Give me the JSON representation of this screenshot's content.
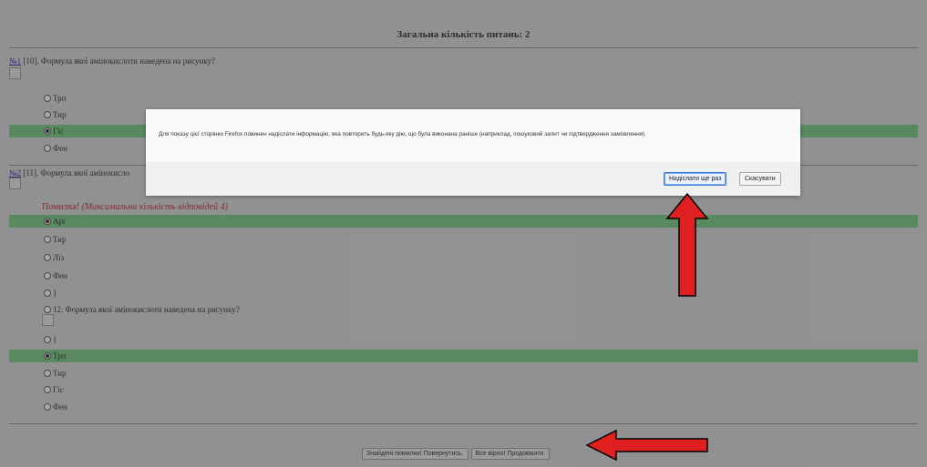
{
  "page": {
    "total_title": "Загальна кількість питань: 2",
    "questions": [
      {
        "number_link": "№1",
        "text": " [10]. Формула якої амінокислоти наведена на рисунку?",
        "options": [
          {
            "label": "Трп",
            "selected": false
          },
          {
            "label": "Тир",
            "selected": false
          },
          {
            "label": "Гіс",
            "selected": true
          },
          {
            "label": "Фен",
            "selected": false
          }
        ]
      },
      {
        "number_link": "№2",
        "text": " [11]. Формула якої амінокисло",
        "error_prefix": "Помилка! ",
        "error_detail": "(Максимальна кількість відповідей 4)",
        "options": [
          {
            "label": "Арг",
            "selected": true
          },
          {
            "label": "Тир",
            "selected": false
          },
          {
            "label": "Ліз",
            "selected": false
          },
          {
            "label": "Фен",
            "selected": false
          },
          {
            "label": "}",
            "selected": false
          },
          {
            "label": "12. Формула якої амінокислоти наведена на рисунку?",
            "selected": false
          },
          {
            "label": "{",
            "selected": false
          },
          {
            "label": "Трп",
            "selected": true
          },
          {
            "label": "Тир",
            "selected": false
          },
          {
            "label": "Гіс",
            "selected": false
          },
          {
            "label": "Фен",
            "selected": false
          }
        ]
      }
    ],
    "buttons": {
      "back": "Знайдені помилки! Повернутись.",
      "continue": "Все вірно! Продовжити."
    }
  },
  "dialog": {
    "message": "Для показу цієї сторінки Firefox повинен надіслати інформацію, яка повторить будь-яку дію, що була виконана раніше (наприклад, пошуковий запит чи підтвердження замовлення).",
    "resend_button": "Надіслати ще раз",
    "cancel_button": "Скасувати"
  },
  "colors": {
    "selected_row": "#6fc97d",
    "error_text": "#c0232f",
    "annotation_arrow": "#e02020"
  }
}
